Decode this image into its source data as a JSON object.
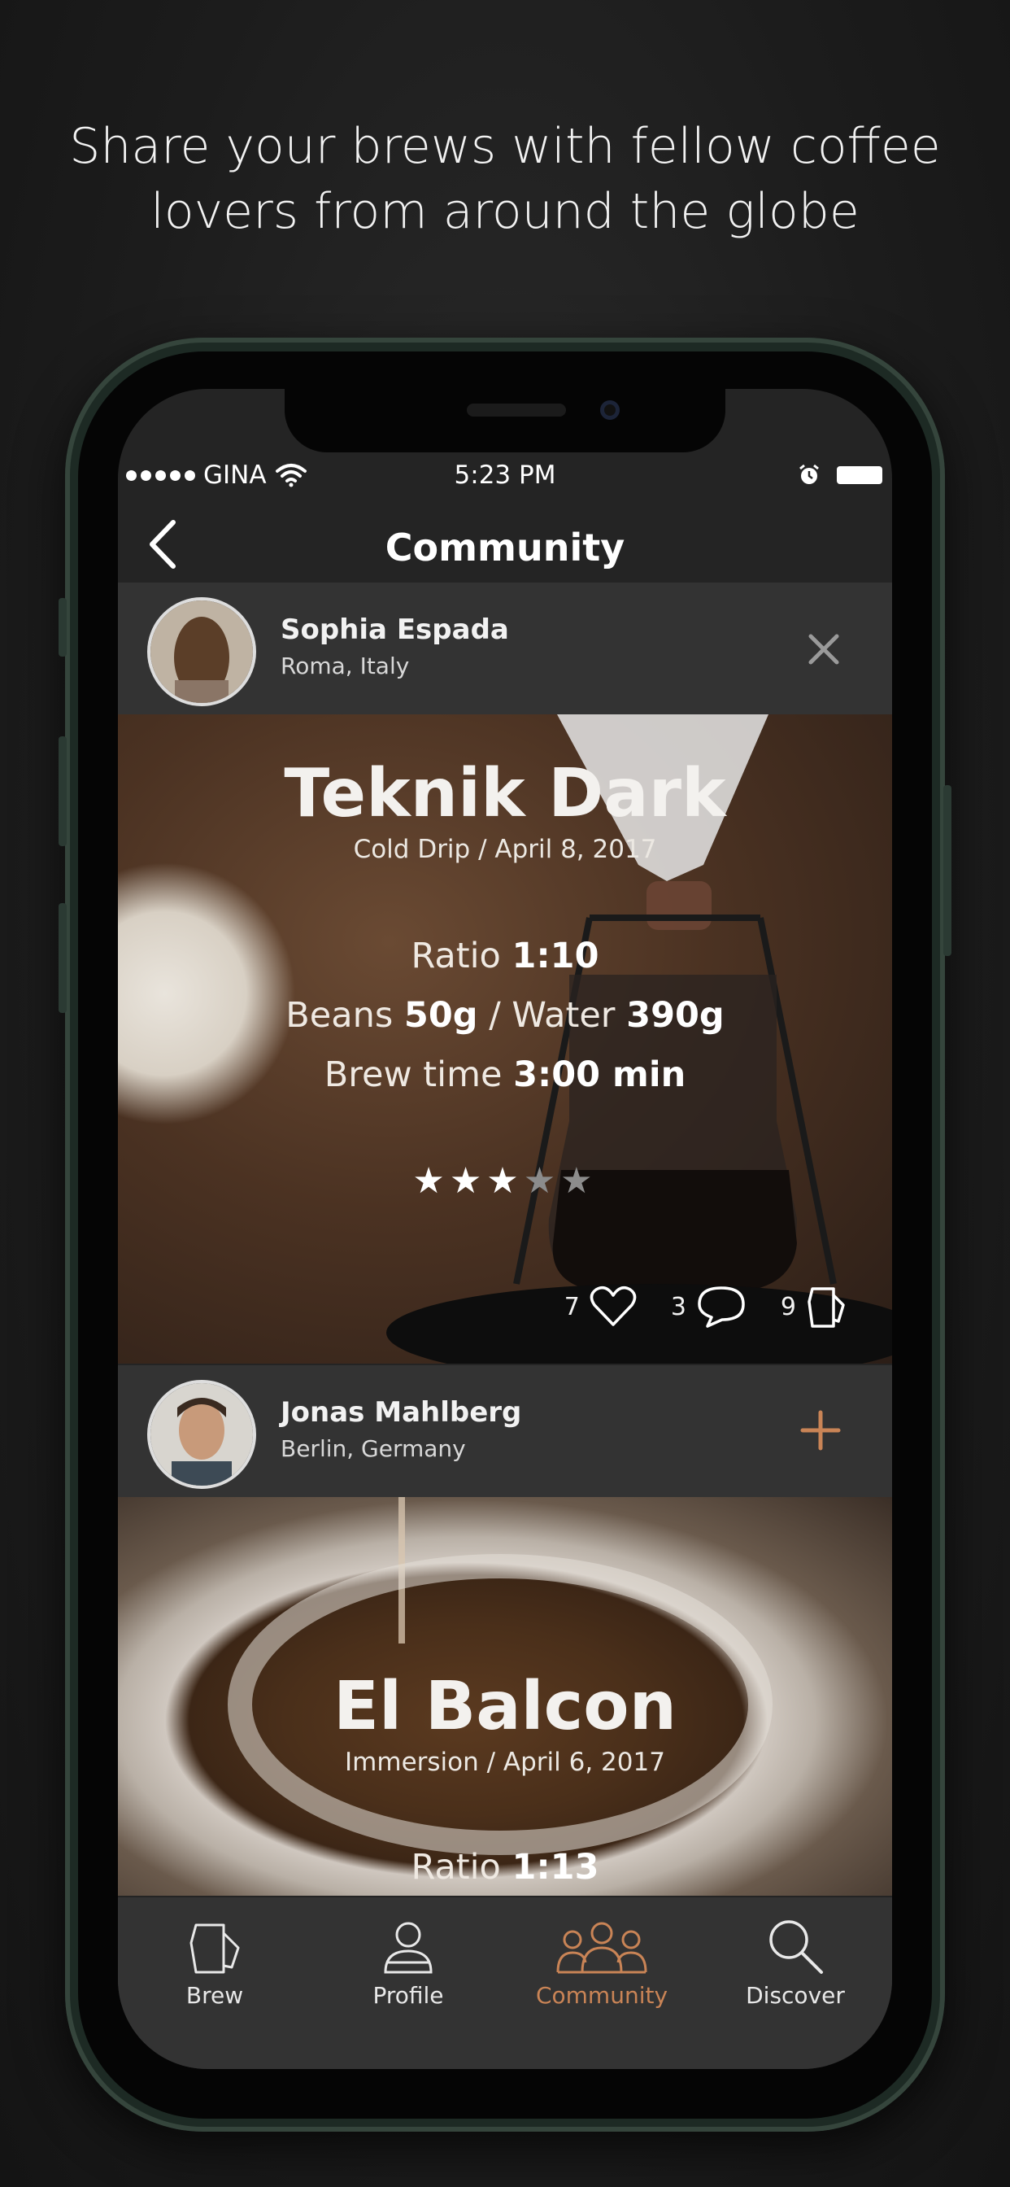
{
  "headline": {
    "line1": "Share your brews with fellow coffee",
    "line2": "lovers from around the globe"
  },
  "status_bar": {
    "carrier": "GINA",
    "time": "5:23 PM",
    "signal_dots": 5
  },
  "nav": {
    "title": "Community",
    "back_icon": "chevron-left-icon"
  },
  "colors": {
    "accent": "#c98456",
    "row_background": "#333333",
    "screen_background": "#242424"
  },
  "posts": [
    {
      "user": {
        "name": "Sophia Espada",
        "location": "Roma, Italy",
        "action_icon": "close-icon"
      },
      "brew": {
        "title": "Teknik Dark",
        "subtitle": "Cold Drip / April 8, 2017",
        "ratio_label": "Ratio",
        "ratio_value": "1:10",
        "beans_label": "Beans",
        "beans_value": "50g",
        "separator": "/",
        "water_label": "Water",
        "water_value": "390g",
        "time_label": "Brew time",
        "time_value": "3:00 min",
        "rating": 3,
        "rating_max": 5
      },
      "metrics": {
        "likes": "7",
        "comments": "3",
        "brews": "9"
      }
    },
    {
      "user": {
        "name": "Jonas Mahlberg",
        "location": "Berlin, Germany",
        "action_icon": "plus-icon"
      },
      "brew": {
        "title": "El Balcon",
        "subtitle": "Immersion / April 6, 2017",
        "ratio_label": "Ratio",
        "ratio_value": "1:13"
      }
    }
  ],
  "tabs": [
    {
      "label": "Brew",
      "icon": "pitcher-icon",
      "active": false
    },
    {
      "label": "Profile",
      "icon": "person-icon",
      "active": false
    },
    {
      "label": "Community",
      "icon": "group-icon",
      "active": true
    },
    {
      "label": "Discover",
      "icon": "search-icon",
      "active": false
    }
  ]
}
